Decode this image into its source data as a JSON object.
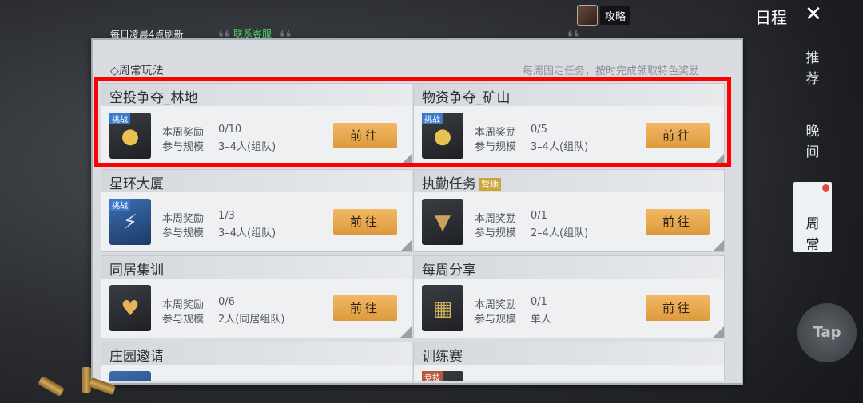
{
  "header": {
    "guide_label": "攻略",
    "title": "日程",
    "close_icon": "close-icon"
  },
  "board": {
    "refresh_text": "每日凌晨4点刷新",
    "service_link": "联系客服",
    "section_title": "◇周常玩法",
    "section_note": "每周固定任务，按时完成领取特色奖励"
  },
  "right_tabs": [
    {
      "label": "推\n荐"
    },
    {
      "label": "晚\n间"
    },
    {
      "label": "周\n常"
    }
  ],
  "cards": [
    {
      "title": "空投争夺_林地",
      "tag": "",
      "badge": "挑战",
      "icon": "coin-icon",
      "reward_label": "本周奖励",
      "reward_value": "0/10",
      "scale_label": "参与规模",
      "scale_value": "3–4人(组队)",
      "button": "前往"
    },
    {
      "title": "物资争夺_矿山",
      "tag": "",
      "badge": "挑战",
      "icon": "coin-icon",
      "reward_label": "本周奖励",
      "reward_value": "0/5",
      "scale_label": "参与规模",
      "scale_value": "3–4人(组队)",
      "button": "前往"
    },
    {
      "title": "星环大厦",
      "tag": "",
      "badge": "挑战",
      "icon": "lightning-icon",
      "reward_label": "本周奖励",
      "reward_value": "1/3",
      "scale_label": "参与规模",
      "scale_value": "3–4人(组队)",
      "button": "前往"
    },
    {
      "title": "执勤任务",
      "tag": "营地",
      "badge": "",
      "icon": "shield-badge-icon",
      "reward_label": "本周奖励",
      "reward_value": "0/1",
      "scale_label": "参与规模",
      "scale_value": "2–4人(组队)",
      "button": "前往"
    },
    {
      "title": "同居集训",
      "tag": "",
      "badge": "",
      "icon": "heart-icon",
      "reward_label": "本周奖励",
      "reward_value": "0/6",
      "scale_label": "参与规模",
      "scale_value": "2人(同居组队)",
      "button": "前往"
    },
    {
      "title": "每周分享",
      "tag": "",
      "badge": "",
      "icon": "crate-icon",
      "reward_label": "本周奖励",
      "reward_value": "0/1",
      "scale_label": "参与规模",
      "scale_value": "单人",
      "button": "前往"
    },
    {
      "title": "庄园邀请",
      "tag": "",
      "badge": "",
      "icon": "blank-icon"
    },
    {
      "title": "训练赛",
      "tag": "",
      "badge": "竞技",
      "icon": "blank-icon"
    }
  ],
  "tap_label": "Tap"
}
